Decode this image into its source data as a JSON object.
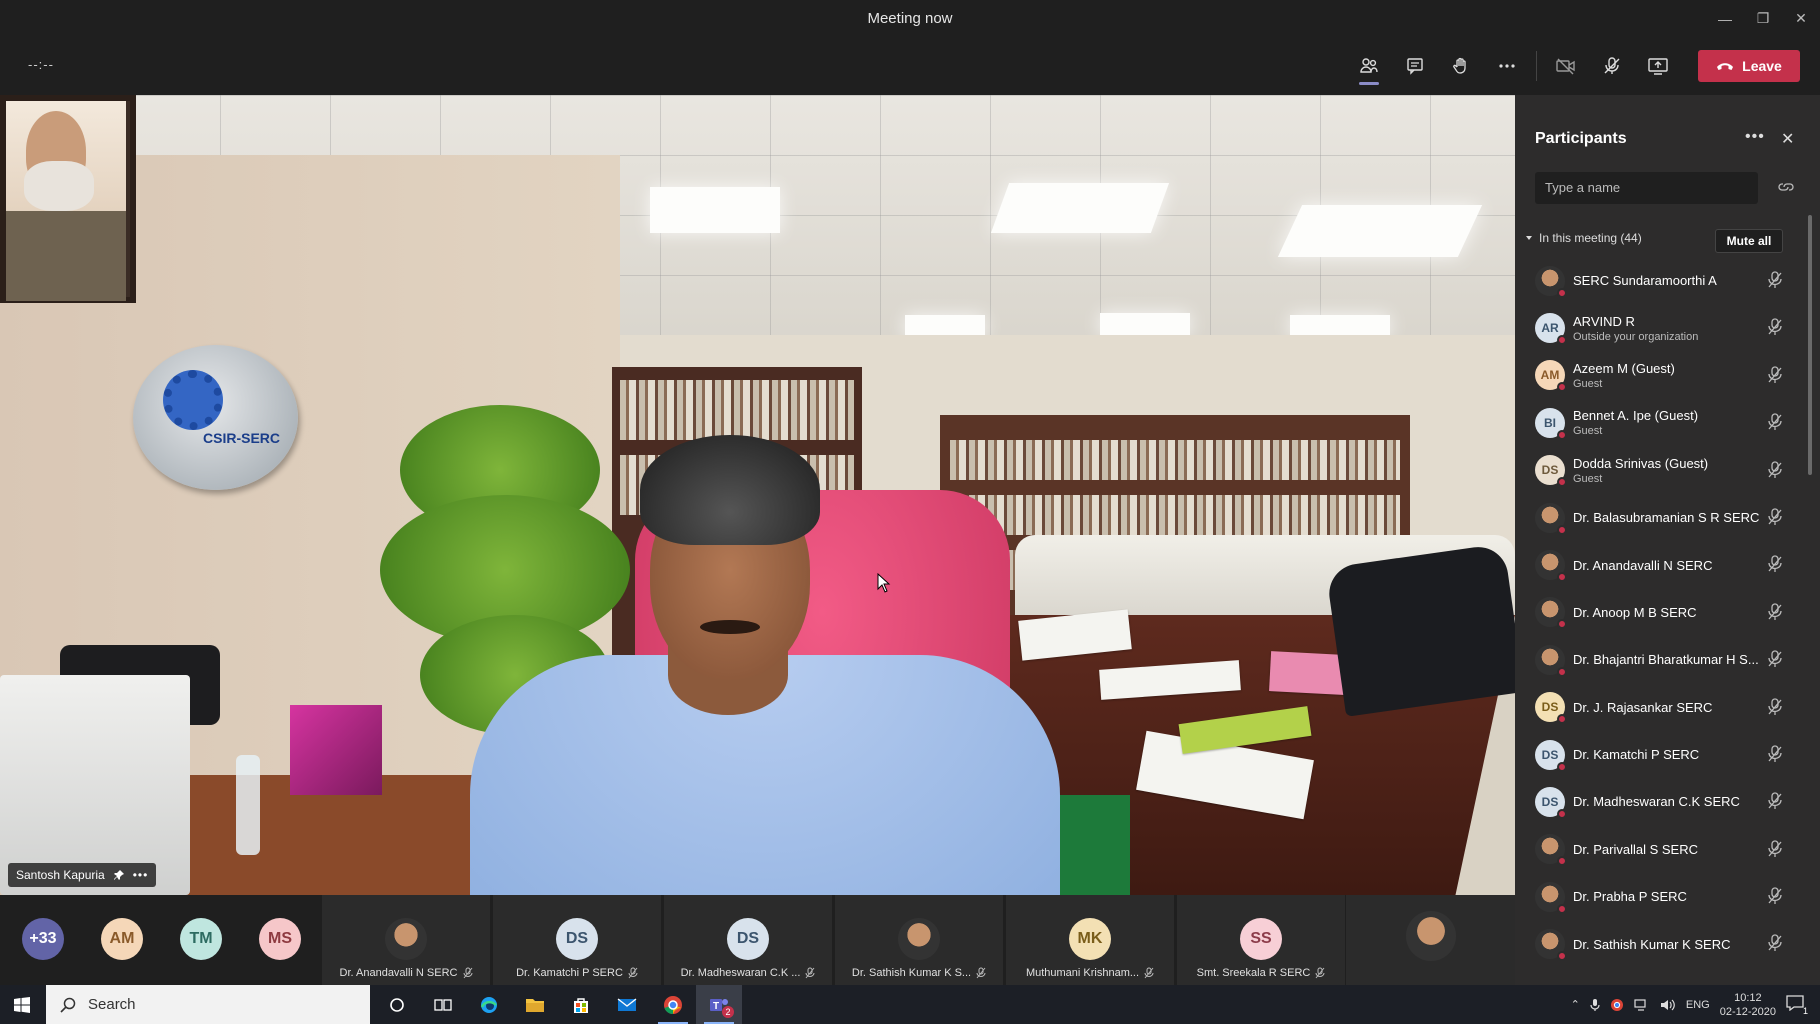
{
  "window": {
    "title": "Meeting now"
  },
  "toolbar": {
    "timer": "--:--",
    "leave_label": "Leave"
  },
  "video": {
    "speaker_name": "Santosh Kapuria",
    "wall_logo_text": "CSIR-SERC"
  },
  "strip": {
    "overflow_count": "+33",
    "avatars": [
      {
        "initials": "AM",
        "bg": "#f5d7b8",
        "fg": "#8a5a2a"
      },
      {
        "initials": "TM",
        "bg": "#bfe6df",
        "fg": "#2d6b61"
      },
      {
        "initials": "MS",
        "bg": "#f6c7c9",
        "fg": "#8e3a40"
      }
    ],
    "tiles": [
      {
        "name": "Dr. Anandavalli N SERC",
        "initials": "",
        "photo": true
      },
      {
        "name": "Dr. Kamatchi P SERC",
        "initials": "DS",
        "bg": "#d8e2ec",
        "fg": "#3c556e"
      },
      {
        "name": "Dr. Madheswaran C.K ...",
        "initials": "DS",
        "bg": "#d8e2ec",
        "fg": "#3c556e"
      },
      {
        "name": "Dr. Sathish Kumar K S...",
        "initials": "",
        "photo": true
      },
      {
        "name": "Muthumani Krishnam...",
        "initials": "MK",
        "bg": "#f3e0b4",
        "fg": "#7a5d1a"
      },
      {
        "name": "Smt. Sreekala R SERC",
        "initials": "SS",
        "bg": "#f7cfd6",
        "fg": "#8c3c4a"
      }
    ]
  },
  "participants": {
    "title": "Participants",
    "search_placeholder": "Type a name",
    "section_label": "In this meeting (44)",
    "mute_all_label": "Mute all",
    "list": [
      {
        "name": "SERC Sundaramoorthi A",
        "sub": "",
        "initials": "",
        "photo": true
      },
      {
        "name": "ARVIND R",
        "sub": "Outside your organization",
        "initials": "AR",
        "bg": "#d8e2ec",
        "fg": "#3c556e"
      },
      {
        "name": "Azeem M (Guest)",
        "sub": "Guest",
        "initials": "AM",
        "bg": "#f5d7b8",
        "fg": "#8a5a2a"
      },
      {
        "name": "Bennet A. Ipe (Guest)",
        "sub": "Guest",
        "initials": "BI",
        "bg": "#d8e2ec",
        "fg": "#3c556e"
      },
      {
        "name": "Dodda Srinivas (Guest)",
        "sub": "Guest",
        "initials": "DS",
        "bg": "#eadfd0",
        "fg": "#6e5a3c"
      },
      {
        "name": "Dr. Balasubramanian S R SERC",
        "sub": "",
        "initials": "",
        "photo": true
      },
      {
        "name": "Dr. Anandavalli N SERC",
        "sub": "",
        "initials": "",
        "photo": true
      },
      {
        "name": "Dr. Anoop M B SERC",
        "sub": "",
        "initials": "",
        "photo": true
      },
      {
        "name": "Dr. Bhajantri Bharatkumar H S...",
        "sub": "",
        "initials": "",
        "photo": true
      },
      {
        "name": "Dr. J. Rajasankar SERC",
        "sub": "",
        "initials": "DS",
        "bg": "#f3e0b4",
        "fg": "#7a5d1a"
      },
      {
        "name": "Dr. Kamatchi P SERC",
        "sub": "",
        "initials": "DS",
        "bg": "#d8e2ec",
        "fg": "#3c556e"
      },
      {
        "name": "Dr. Madheswaran C.K SERC",
        "sub": "",
        "initials": "DS",
        "bg": "#d8e2ec",
        "fg": "#3c556e"
      },
      {
        "name": "Dr. Parivallal S SERC",
        "sub": "",
        "initials": "",
        "photo": true
      },
      {
        "name": "Dr. Prabha P SERC",
        "sub": "",
        "initials": "",
        "photo": true
      },
      {
        "name": "Dr. Sathish Kumar K SERC",
        "sub": "",
        "initials": "",
        "photo": true
      }
    ]
  },
  "taskbar": {
    "search_placeholder": "Search",
    "language": "ENG",
    "time": "10:12",
    "date": "02-12-2020",
    "notification_count": "1",
    "teams_badge": "2"
  },
  "colors": {
    "leave": "#c4314b",
    "panel_bg": "#2d2c2c",
    "accent": "#8b8cc7"
  }
}
